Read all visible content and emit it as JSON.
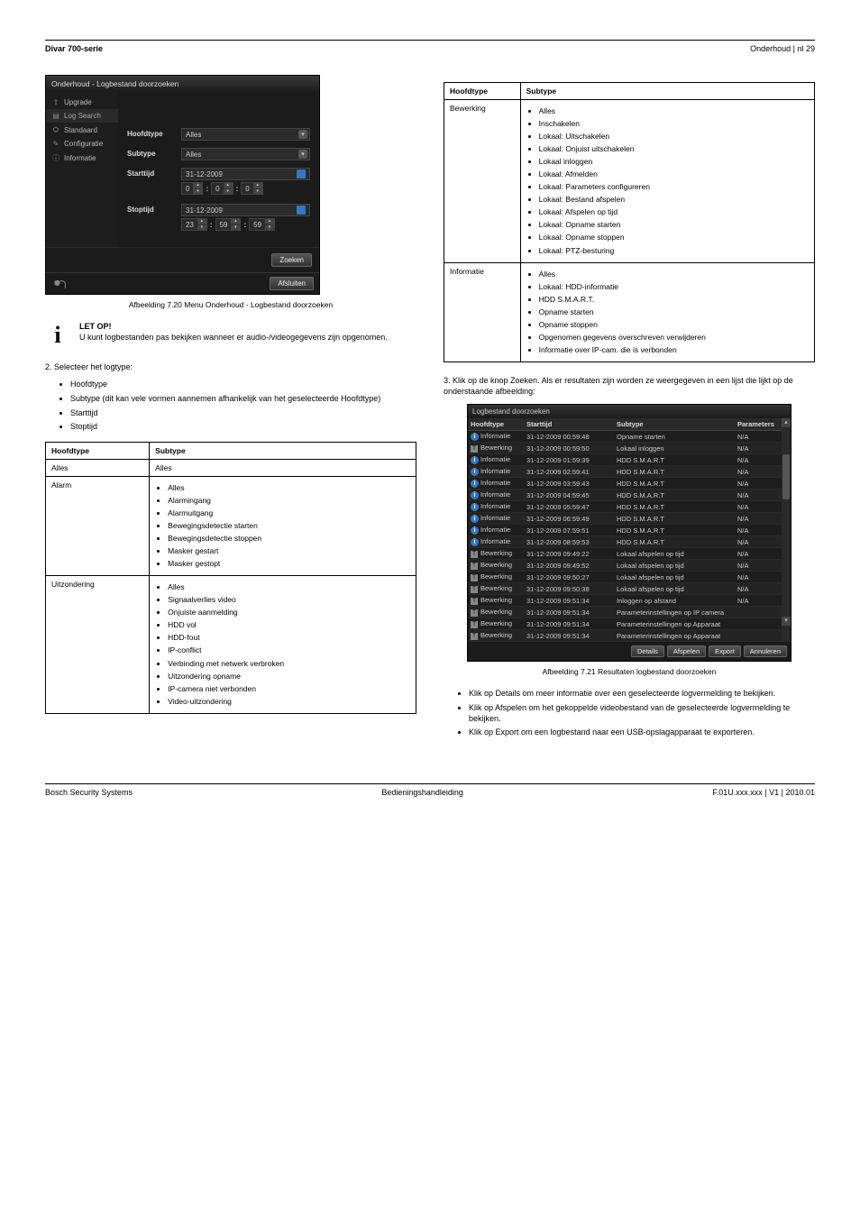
{
  "header": {
    "left": "Divar 700-serie",
    "right": "Onderhoud | nl  29"
  },
  "footer": {
    "left": "Bosch Security Systems",
    "center": "Bedieningshandleiding",
    "right": "F.01U.xxx.xxx | V1 | 2010.01"
  },
  "note": {
    "icon": "i",
    "label": "LET OP!",
    "text": "U kunt logbestanden pas bekijken wanneer er audio-/videogegevens zijn opgenomen."
  },
  "para2": "2.   Selecteer het logtype:",
  "list_logtypes": [
    "Hoofdtype",
    "Subtype (dit kan vele vormen aannemen afhankelijk van het geselecteerde Hoofdtype)",
    "Starttijd",
    "Stoptijd"
  ],
  "table1": {
    "head": [
      "Hoofdtype",
      "Subtype"
    ],
    "rows": [
      [
        "Alles",
        "Alles"
      ],
      [
        "Alarm",
        [
          "Alles",
          "Alarmingang",
          "Alarmuitgang",
          "Bewegingsdetectie starten",
          "Bewegingsdetectie stoppen",
          "Masker gestart",
          "Masker gestopt"
        ]
      ],
      [
        "Uitzondering",
        [
          "Alles",
          "Signaalverlies video",
          "Onjuiste aanmelding",
          "HDD vol",
          "HDD-fout",
          "IP-conflict",
          "Verbinding met netwerk verbroken",
          "Uitzondering opname",
          "IP-camera niet verbonden",
          "Video-uitzondering"
        ]
      ]
    ]
  },
  "table2": {
    "head": [
      "Hoofdtype",
      "Subtype"
    ],
    "rows": [
      [
        "Bewerking",
        [
          "Alles",
          "Inschakelen",
          "Lokaal: Uitschakelen",
          "Lokaal: Onjuist uitschakelen",
          "Lokaal inloggen",
          "Lokaal: Afmelden",
          "Lokaal: Parameters configureren",
          "Lokaal: Bestand afspelen",
          "Lokaal: Afspelen op tijd",
          "Lokaal: Opname starten",
          "Lokaal: Opname stoppen",
          "Lokaal: PTZ-besturing"
        ]
      ],
      [
        "Informatie",
        [
          "Alles",
          "Lokaal: HDD-informatie",
          "HDD S.M.A.R.T.",
          "Opname starten",
          "Opname stoppen",
          "Opgenomen gegevens overschreven verwijderen",
          "Informatie over IP-cam. die is verbonden"
        ]
      ]
    ]
  },
  "para3": "3.   Klik op de knop Zoeken. Als er resultaten zijn worden ze weergegeven in een lijst die lijkt op de onderstaande afbeelding:",
  "bottom_list": [
    "Klik op Details om meer informatie over een geselecteerde logvermelding te bekijken.",
    "Klik op Afspelen om het gekoppelde videobestand van de geselecteerde logvermelding te bekijken.",
    "Klik op Export om een logbestand naar een USB-opslagapparaat te exporteren."
  ],
  "fig1": {
    "title": "Onderhoud - Logbestand doorzoeken",
    "side": [
      "Upgrade",
      "Log Search",
      "Standaard",
      "Configuratie",
      "Informatie"
    ],
    "side_sel_index": 1,
    "labels": {
      "hoofdtype": "Hoofdtype",
      "subtype": "Subtype",
      "starttijd": "Starttijd",
      "stoptijd": "Stoptijd"
    },
    "select_val": "Alles",
    "date1": "31-12-2009",
    "time1": [
      "0",
      "0",
      "0"
    ],
    "date2": "31-12-2009",
    "time2": [
      "23",
      "59",
      "59"
    ],
    "btn_search": "Zoeken",
    "btn_close": "Afsluiten",
    "caption": "Afbeelding 7.20   Menu Onderhoud - Logbestand doorzoeken"
  },
  "fig2": {
    "title": "Logbestand doorzoeken",
    "cols": [
      "Hoofdtype",
      "Starttijd",
      "Subtype",
      "Parameters"
    ],
    "rows": [
      [
        "i",
        "Informatie",
        "31-12-2009 00:59:48",
        "Opname starten",
        "N/A"
      ],
      [
        "t",
        "Bewerking",
        "31-12-2009 00:59:50",
        "Lokaal inloggen",
        "N/A"
      ],
      [
        "i",
        "Informatie",
        "31-12-2009 01:59:39",
        "HDD S.M.A.R.T",
        "N/A"
      ],
      [
        "i",
        "Informatie",
        "31-12-2009 02:59:41",
        "HDD S.M.A.R.T",
        "N/A"
      ],
      [
        "i",
        "Informatie",
        "31-12-2009 03:59:43",
        "HDD S.M.A.R.T",
        "N/A"
      ],
      [
        "i",
        "Informatie",
        "31-12-2009 04:59:45",
        "HDD S.M.A.R.T",
        "N/A"
      ],
      [
        "i",
        "Informatie",
        "31-12-2009 05:59:47",
        "HDD S.M.A.R.T",
        "N/A"
      ],
      [
        "i",
        "Informatie",
        "31-12-2009 06:59:49",
        "HDD S.M.A.R.T",
        "N/A"
      ],
      [
        "i",
        "Informatie",
        "31-12-2009 07:59:51",
        "HDD S.M.A.R.T",
        "N/A"
      ],
      [
        "i",
        "Informatie",
        "31-12-2009 08:59:53",
        "HDD S.M.A.R.T",
        "N/A"
      ],
      [
        "t",
        "Bewerking",
        "31-12-2009 09:49:22",
        "Lokaal afspelen op tijd",
        "N/A"
      ],
      [
        "t",
        "Bewerking",
        "31-12-2009 09:49:52",
        "Lokaal afspelen op tijd",
        "N/A"
      ],
      [
        "t",
        "Bewerking",
        "31-12-2009 09:50:27",
        "Lokaal afspelen op tijd",
        "N/A"
      ],
      [
        "t",
        "Bewerking",
        "31-12-2009 09:50:38",
        "Lokaal afspelen op tijd",
        "N/A"
      ],
      [
        "t",
        "Bewerking",
        "31-12-2009 09:51:34",
        "Inloggen op afstand",
        "N/A"
      ],
      [
        "t",
        "Bewerking",
        "31-12-2009 09:51:34",
        "Parameterinstellingen op IP camera",
        ""
      ],
      [
        "t",
        "Bewerking",
        "31-12-2009 09:51:34",
        "Parameterinstellingen op Apparaat",
        ""
      ],
      [
        "t",
        "Bewerking",
        "31-12-2009 09:51:34",
        "Parameterinstellingen op Apparaat",
        ""
      ]
    ],
    "btns": [
      "Details",
      "Afspelen",
      "Export",
      "Annuleren"
    ],
    "caption": "Afbeelding 7.21   Resultaten logbestand doorzoeken"
  }
}
